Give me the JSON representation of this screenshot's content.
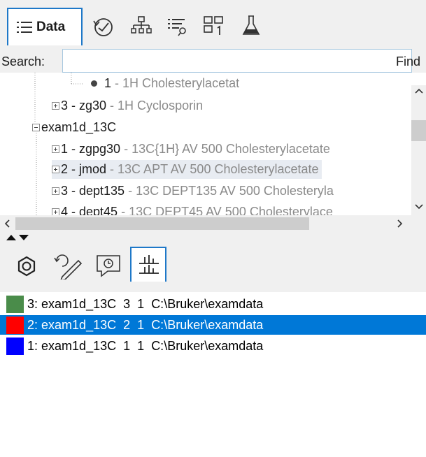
{
  "toolbar": {
    "data_tab_label": "Data",
    "icons": [
      "list-icon",
      "history-icon",
      "hierarchy-icon",
      "filter-list-icon",
      "layout-1-icon",
      "flask-icon"
    ]
  },
  "search": {
    "label": "Search:",
    "value": "",
    "find_label": "Find"
  },
  "tree": {
    "rows": [
      {
        "name": "1",
        "desc": "1H Cholesterylacetat",
        "type": "leaf"
      },
      {
        "name": "3 - zg30",
        "desc": "1H Cyclosporin",
        "type": "collapsed"
      },
      {
        "name": "exam1d_13C",
        "desc": "",
        "type": "expanded"
      },
      {
        "name": "1 - zgpg30",
        "desc": "13C{1H} AV 500 Cholesterylacetate",
        "type": "collapsed"
      },
      {
        "name": "2 - jmod",
        "desc": "13C APT AV 500 Cholesterylacetate",
        "type": "collapsed",
        "selected": true
      },
      {
        "name": "3 - dept135",
        "desc": "13C DEPT135 AV 500 Cholesteryla",
        "type": "collapsed"
      },
      {
        "name": "4 - dept45",
        "desc": "13C DEPT45 AV 500 Cholesterylace",
        "type": "collapsed"
      }
    ]
  },
  "bottom_toolbar": {
    "icons": [
      "structure-icon",
      "edit-history-icon",
      "comment-history-icon",
      "grid-layout-icon"
    ]
  },
  "datasets": {
    "rows": [
      {
        "index": "3:",
        "name": "exam1d_13C",
        "expno": "3",
        "procno": "1",
        "path": "C:\\Bruker\\examdata",
        "color": "#4a8c4a",
        "selected": false
      },
      {
        "index": "2:",
        "name": "exam1d_13C",
        "expno": "2",
        "procno": "1",
        "path": "C:\\Bruker\\examdata",
        "color": "#ff0000",
        "selected": true
      },
      {
        "index": "1:",
        "name": "exam1d_13C",
        "expno": "1",
        "procno": "1",
        "path": "C:\\Bruker\\examdata",
        "color": "#0000ff",
        "selected": false
      }
    ]
  },
  "colors": {
    "accent": "#1e78c8",
    "selection": "#0078d7",
    "toolbar_bg": "#f0f0f0"
  }
}
